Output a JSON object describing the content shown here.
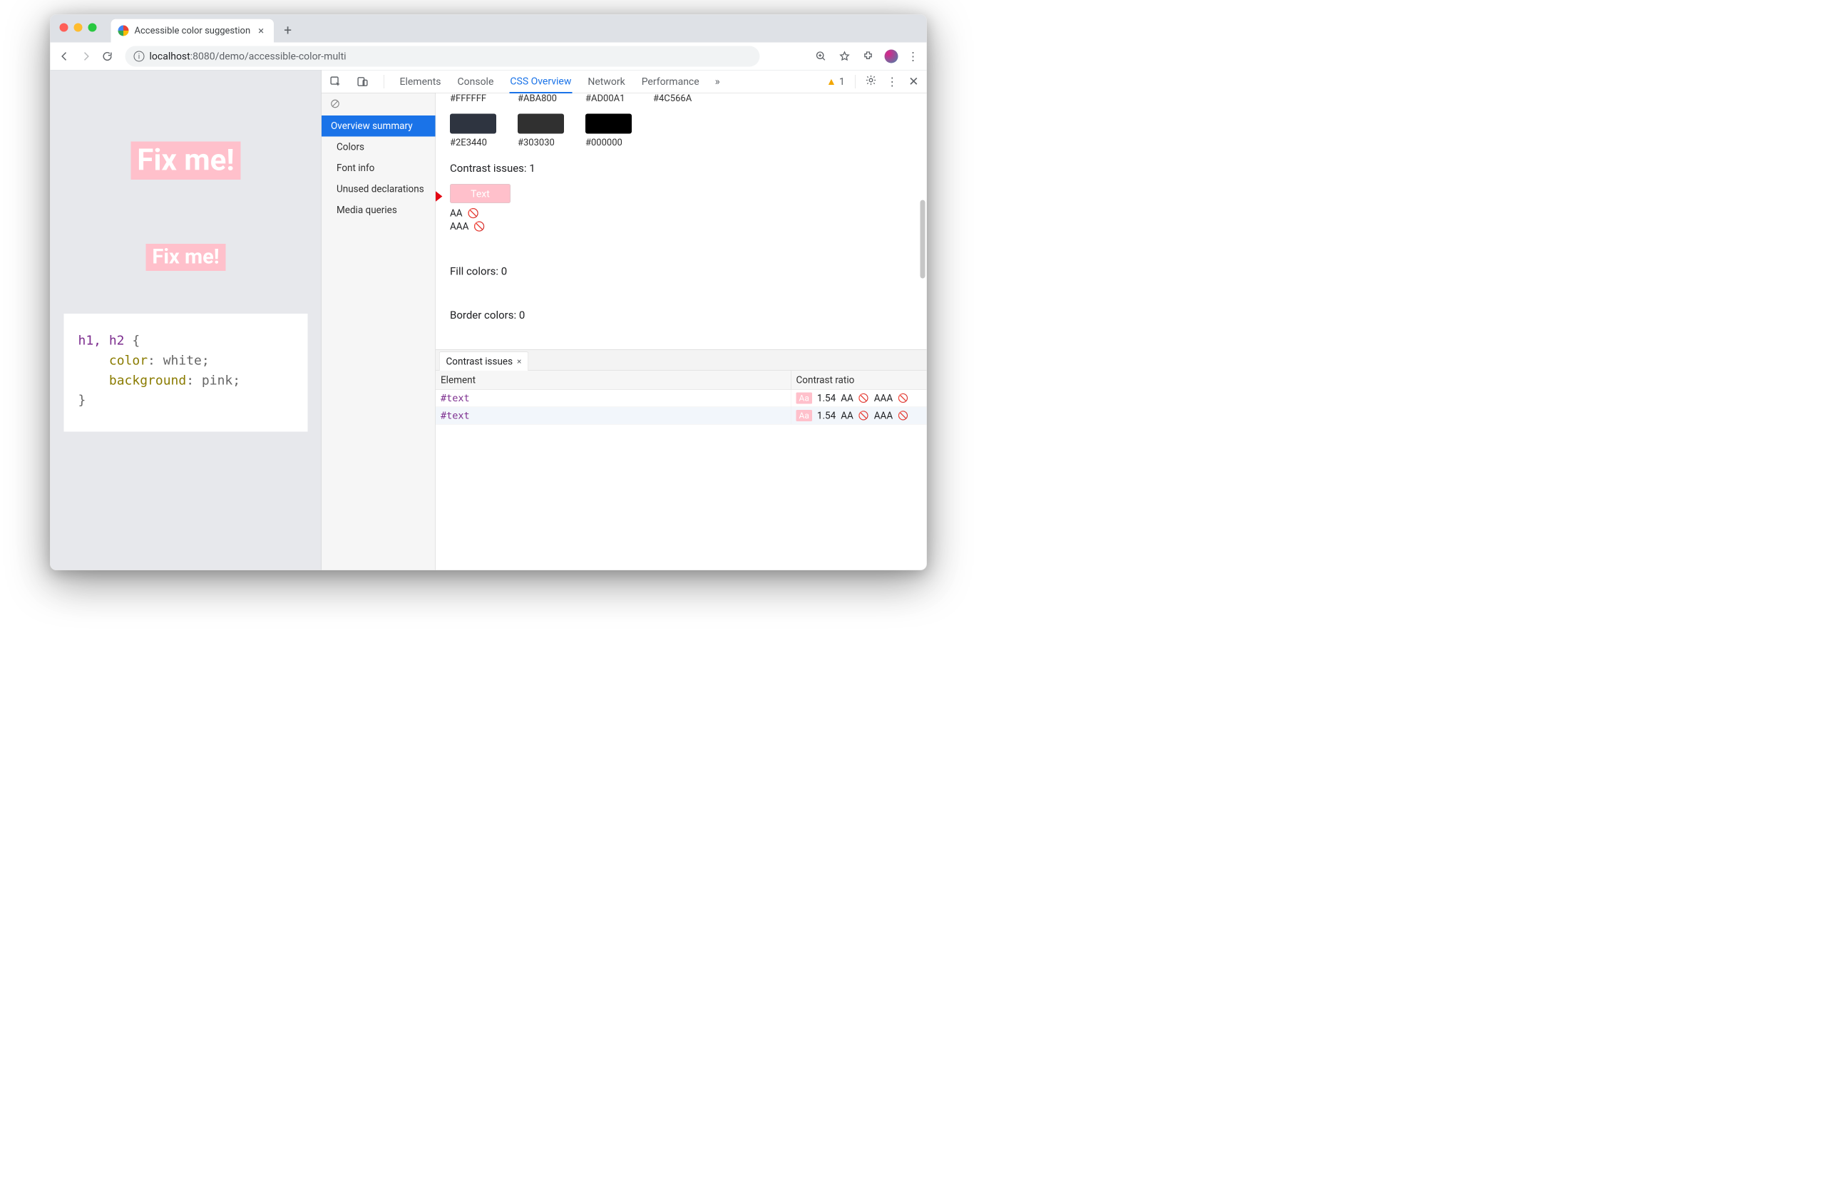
{
  "browser": {
    "tab_title": "Accessible color suggestion",
    "url_host": "localhost",
    "url_port": ":8080",
    "url_path": "/demo/accessible-color-multi"
  },
  "page": {
    "h1": "Fix me!",
    "h2": "Fix me!",
    "code_selector": "h1, h2",
    "code_brace_open": " {",
    "code_prop1": "color",
    "code_val1": ": white;",
    "code_prop2": "background",
    "code_val2": ": pink;",
    "code_brace_close": "}"
  },
  "devtools": {
    "tabs": {
      "elements": "Elements",
      "console": "Console",
      "css_overview": "CSS Overview",
      "network": "Network",
      "performance": "Performance",
      "more": "»"
    },
    "warning_count": "1",
    "sidebar": {
      "overview": "Overview summary",
      "colors": "Colors",
      "font": "Font info",
      "unused": "Unused declarations",
      "media": "Media queries"
    },
    "top_swatches": [
      {
        "hex": "#FFFFFF"
      },
      {
        "hex": "#ABA800"
      },
      {
        "hex": "#AD00A1"
      },
      {
        "hex": "#4C566A"
      }
    ],
    "dark_swatches": [
      {
        "hex": "#2E3440",
        "bg": "#2E3440"
      },
      {
        "hex": "#303030",
        "bg": "#303030"
      },
      {
        "hex": "#000000",
        "bg": "#000000"
      }
    ],
    "contrast_heading": "Contrast issues: 1",
    "contrast_sample_text": "Text",
    "aa_label": "AA",
    "aaa_label": "AAA",
    "fill_heading": "Fill colors: 0",
    "border_heading": "Border colors: 0",
    "issues_tab": "Contrast issues",
    "col_element": "Element",
    "col_ratio": "Contrast ratio",
    "rows": [
      {
        "el": "#text",
        "chip": "Aa",
        "ratio": "1.54",
        "aa": "AA",
        "aaa": "AAA"
      },
      {
        "el": "#text",
        "chip": "Aa",
        "ratio": "1.54",
        "aa": "AA",
        "aaa": "AAA"
      }
    ]
  }
}
